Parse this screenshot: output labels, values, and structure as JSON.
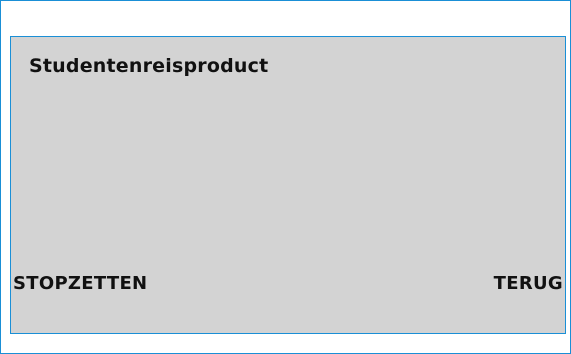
{
  "panel": {
    "title": "Studentenreisproduct"
  },
  "softkeys": {
    "left_label": "STOPZETTEN",
    "right_label": "TERUG"
  },
  "colors": {
    "border": "#1a8fd6",
    "panel_background": "#d3d3d3",
    "text": "#111111"
  }
}
